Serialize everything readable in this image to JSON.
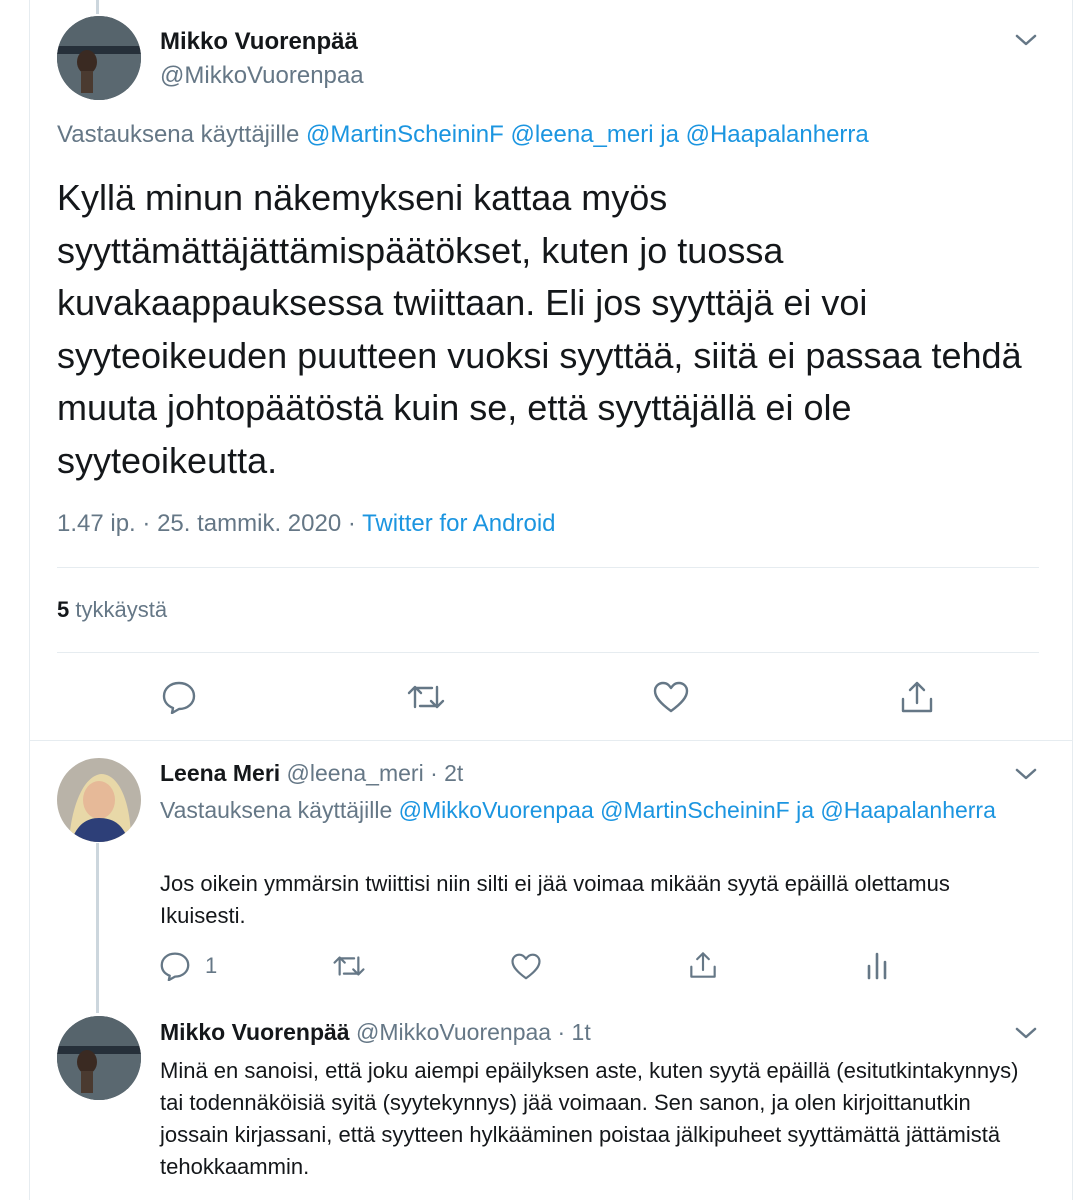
{
  "main_tweet": {
    "name": "Mikko Vuorenpää",
    "handle": "@MikkoVuorenpaa",
    "reply_prefix": "Vastauksena käyttäjille",
    "reply_mention_1": "@MartinScheininF",
    "reply_mention_2": "@leena_meri",
    "reply_conj": "ja",
    "reply_mention_3": "@Haapalanherra",
    "text": "Kyllä minun näkemykseni kattaa myös syyttämättäjättämispäätökset, kuten jo tuossa kuvakaappauksessa twiittaan. Eli jos syyttäjä ei voi syyteoikeuden puutteen vuoksi syyttää, siitä ei passaa tehdä muuta johtopäätöstä kuin se, että syyttäjällä ei ole syyteoikeutta.",
    "time": "1.47 ip.",
    "sep": "·",
    "date": "25. tammik. 2020",
    "source": "Twitter for Android",
    "likes_count": "5",
    "likes_label": "tykkäystä",
    "actions": [
      "reply-icon",
      "retweet-icon",
      "like-icon",
      "share-icon"
    ]
  },
  "reply_1": {
    "name": "Leena Meri",
    "handle": "@leena_meri",
    "sep": "·",
    "age": "2t",
    "reply_prefix": "Vastauksena käyttäjille",
    "reply_mention_1": "@MikkoVuorenpaa",
    "reply_mention_2": "@MartinScheininF",
    "reply_conj": "ja",
    "reply_mention_3": "@Haapalanherra",
    "text": "Jos oikein ymmärsin twiittisi niin silti ei jää voimaa mikään syytä epäillä olettamus Ikuisesti.",
    "reply_count": "1",
    "actions": [
      "reply-icon",
      "retweet-icon",
      "like-icon",
      "share-icon",
      "analytics-icon"
    ]
  },
  "reply_2": {
    "name": "Mikko Vuorenpää",
    "handle": "@MikkoVuorenpaa",
    "sep": "·",
    "age": "1t",
    "text": "Minä en sanoisi, että joku aiempi epäilyksen aste, kuten syytä epäillä (esitutkintakynnys) tai todennäköisiä syitä (syytekynnys) jää voimaan. Sen sanon, ja olen kirjoittanutkin jossain kirjassani, että syytteen hylkääminen poistaa jälkipuheet syyttämättä jättämistä tehokkaammin."
  },
  "colors": {
    "link": "#1b95e0",
    "secondary": "#657786",
    "primary": "#14171a",
    "border": "#e6ecf0",
    "thread": "#ccd6dd"
  }
}
